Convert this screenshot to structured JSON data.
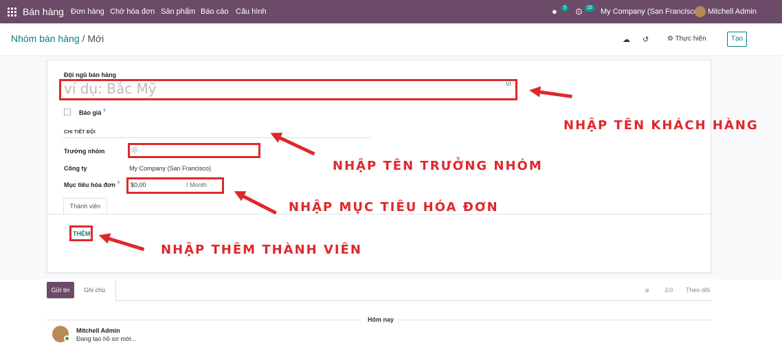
{
  "topbar": {
    "brand": "Bán hàng",
    "menu": [
      "Đơn hàng",
      "Chờ hóa đơn",
      "Sản phẩm",
      "Báo cáo",
      "Cấu hình"
    ],
    "messages_count": "5",
    "activities_count": "15",
    "company": "My Company (San Francisco)",
    "user": "Mitchell Admin"
  },
  "breadcrumb": {
    "parent": "Nhóm bán hàng",
    "separator": " / ",
    "current": "Mới"
  },
  "control": {
    "action_label": "Thực hiện",
    "create_label": "Tạo"
  },
  "form": {
    "team_label": "Đội ngũ bán hàng",
    "team_placeholder": "ví dụ: Bắc Mỹ",
    "lang_badge": "VI",
    "quotation_label": "Báo giá",
    "help_mark": "?",
    "section_title": "CHI TIẾT ĐỘI",
    "leader_label": "Trưởng nhóm",
    "company_label": "Công ty",
    "company_value": "My Company (San Francisco)",
    "target_label": "Mục tiêu hóa đơn",
    "target_value": "$0,00",
    "target_period": "/ Month",
    "tab_members": "Thành viên",
    "add_label": "THÊM"
  },
  "annotations": {
    "customer_name": "NHẬP TÊN KHÁCH HÀNG",
    "leader": "NHẬP TÊN TRƯỞNG NHÓM",
    "target": "NHẬP MỤC TIÊU HÓA ĐƠN",
    "members": "NHẬP THÊM THÀNH VIÊN",
    "color": "#e0272b"
  },
  "chatter": {
    "send_label": "Gửi tin",
    "note_label": "Ghi chú",
    "followers_count": "0",
    "follow_label": "Theo dõi",
    "date_label": "Hôm nay",
    "author": "Mitchell Admin",
    "message": "Đang tạo hồ sơ mới..."
  },
  "colors": {
    "topbar": "#6c4b68",
    "accent": "#017e84"
  }
}
